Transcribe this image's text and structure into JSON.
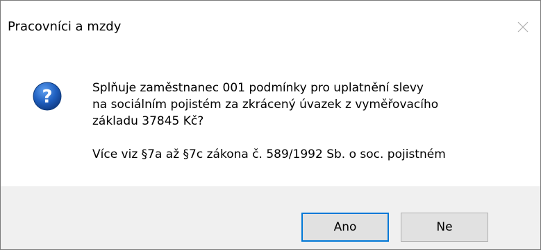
{
  "window": {
    "title": "Pracovníci a mzdy",
    "close_icon": "close-icon"
  },
  "message": {
    "icon": "question-icon",
    "line1": "Splňuje zaměstnanec 001 podmínky pro uplatnění slevy",
    "line2": "na sociálním pojistém za zkrácený úvazek z vyměřovacího",
    "line3": "základu 37845 Kč?",
    "line4": "Více viz §7a až §7c zákona č. 589/1992 Sb. o soc. pojistném"
  },
  "buttons": {
    "yes_label": "Ano",
    "no_label": "Ne"
  },
  "colors": {
    "accent": "#0078d7",
    "icon_blue": "#1f5fbf",
    "footer_bg": "#f0f0f0"
  }
}
